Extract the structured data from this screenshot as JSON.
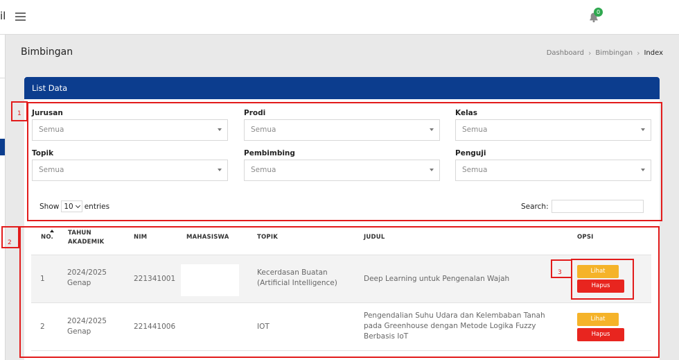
{
  "header": {
    "brand_fragment": "il",
    "notifications_count": "0"
  },
  "page": {
    "title": "Bimbingan",
    "breadcrumb": [
      "Dashboard",
      "Bimbingan",
      "Index"
    ]
  },
  "card": {
    "title": "List Data"
  },
  "filters": [
    {
      "label": "Jurusan",
      "value": "Semua"
    },
    {
      "label": "Prodi",
      "value": "Semua"
    },
    {
      "label": "Kelas",
      "value": "Semua"
    },
    {
      "label": "Topik",
      "value": "Semua"
    },
    {
      "label": "Pembimbing",
      "value": "Semua"
    },
    {
      "label": "Penguji",
      "value": "Semua"
    }
  ],
  "table_controls": {
    "show_label": "Show",
    "page_length": "10",
    "entries_label": "entries",
    "search_label": "Search:"
  },
  "table": {
    "columns": [
      "NO.",
      "TAHUN AKADEMIK",
      "NIM",
      "MAHASISWA",
      "TOPIK",
      "JUDUL",
      "OPSI"
    ],
    "rows": [
      {
        "no": "1",
        "tahun": "2024/2025 Genap",
        "nim": "221341001",
        "mahasiswa": "",
        "topik": "Kecerdasan Buatan (Artificial Intelligence)",
        "judul": "Deep Learning untuk Pengenalan Wajah"
      },
      {
        "no": "2",
        "tahun": "2024/2025 Genap",
        "nim": "221441006",
        "mahasiswa": "",
        "topik": "IOT",
        "judul": "Pengendalian Suhu Udara dan Kelembaban Tanah pada Greenhouse dengan Metode Logika Fuzzy Berbasis IoT"
      }
    ],
    "btn_view": "Lihat",
    "btn_delete": "Hapus"
  },
  "annotations": [
    "1",
    "2",
    "3"
  ],
  "colors": {
    "primary": "#0c3d8e",
    "lihat": "#f5b329",
    "hapus": "#e8251f",
    "annotation": "#e21b1b",
    "badge": "#2fa84f"
  },
  "icons": [
    "menu-icon",
    "bell-icon",
    "caret-down-icon",
    "sort-asc-icon"
  ]
}
